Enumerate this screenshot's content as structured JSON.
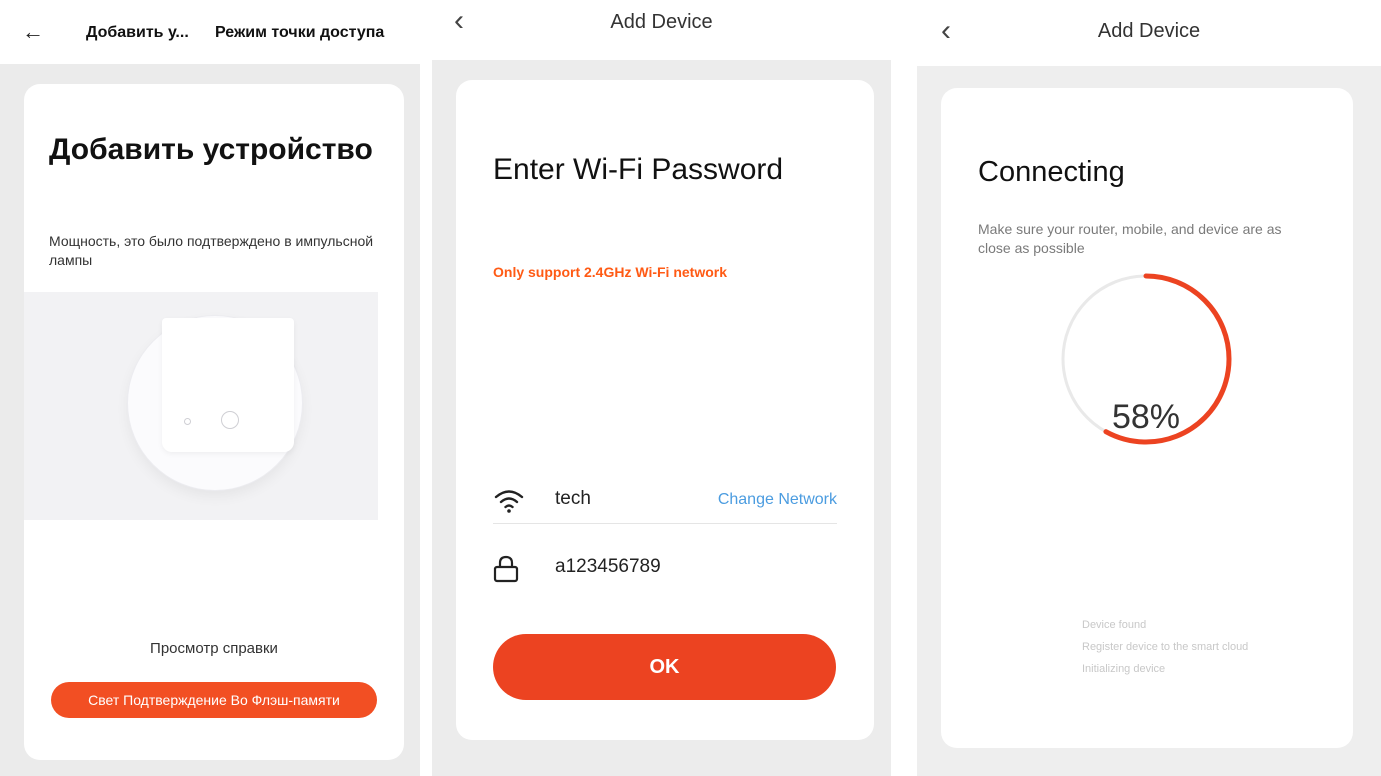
{
  "colors": {
    "accent": "#f24f23",
    "warning_text": "#ff5a14",
    "link": "#4b9ce0",
    "background": "#ebebeb"
  },
  "panel1": {
    "header": {
      "back_icon": "arrow-left-icon",
      "back_glyph": "←",
      "title": "Добавить у...",
      "action": "Режим точки доступа"
    },
    "card": {
      "title": "Добавить устройство",
      "description": "Мощность, это было подтверждено в импульсной лампы",
      "illustration_icon": "smart-bulb-icon",
      "help_link": "Просмотр справки",
      "confirm_button": "Свет Подтверждение Во Флэш-памяти"
    }
  },
  "panel2": {
    "header": {
      "back_icon": "chevron-left-icon",
      "back_glyph": "‹",
      "title": "Add Device"
    },
    "card": {
      "title": "Enter Wi-Fi Password",
      "warning": "Only support 2.4GHz Wi-Fi network",
      "wifi_icon": "wifi-icon",
      "wifi_name": "tech",
      "change_network": "Change Network",
      "lock_icon": "lock-icon",
      "password_value": "a123456789",
      "ok_button": "OK"
    }
  },
  "panel3": {
    "header": {
      "back_icon": "chevron-left-icon",
      "back_glyph": "‹",
      "title": "Add Device"
    },
    "card": {
      "title": "Connecting",
      "description": "Make sure your router, mobile, and device are as close as possible",
      "progress_percent": 58,
      "progress_label": "58%",
      "steps": [
        "Device found",
        "Register device to the smart cloud",
        "Initializing device"
      ]
    }
  }
}
